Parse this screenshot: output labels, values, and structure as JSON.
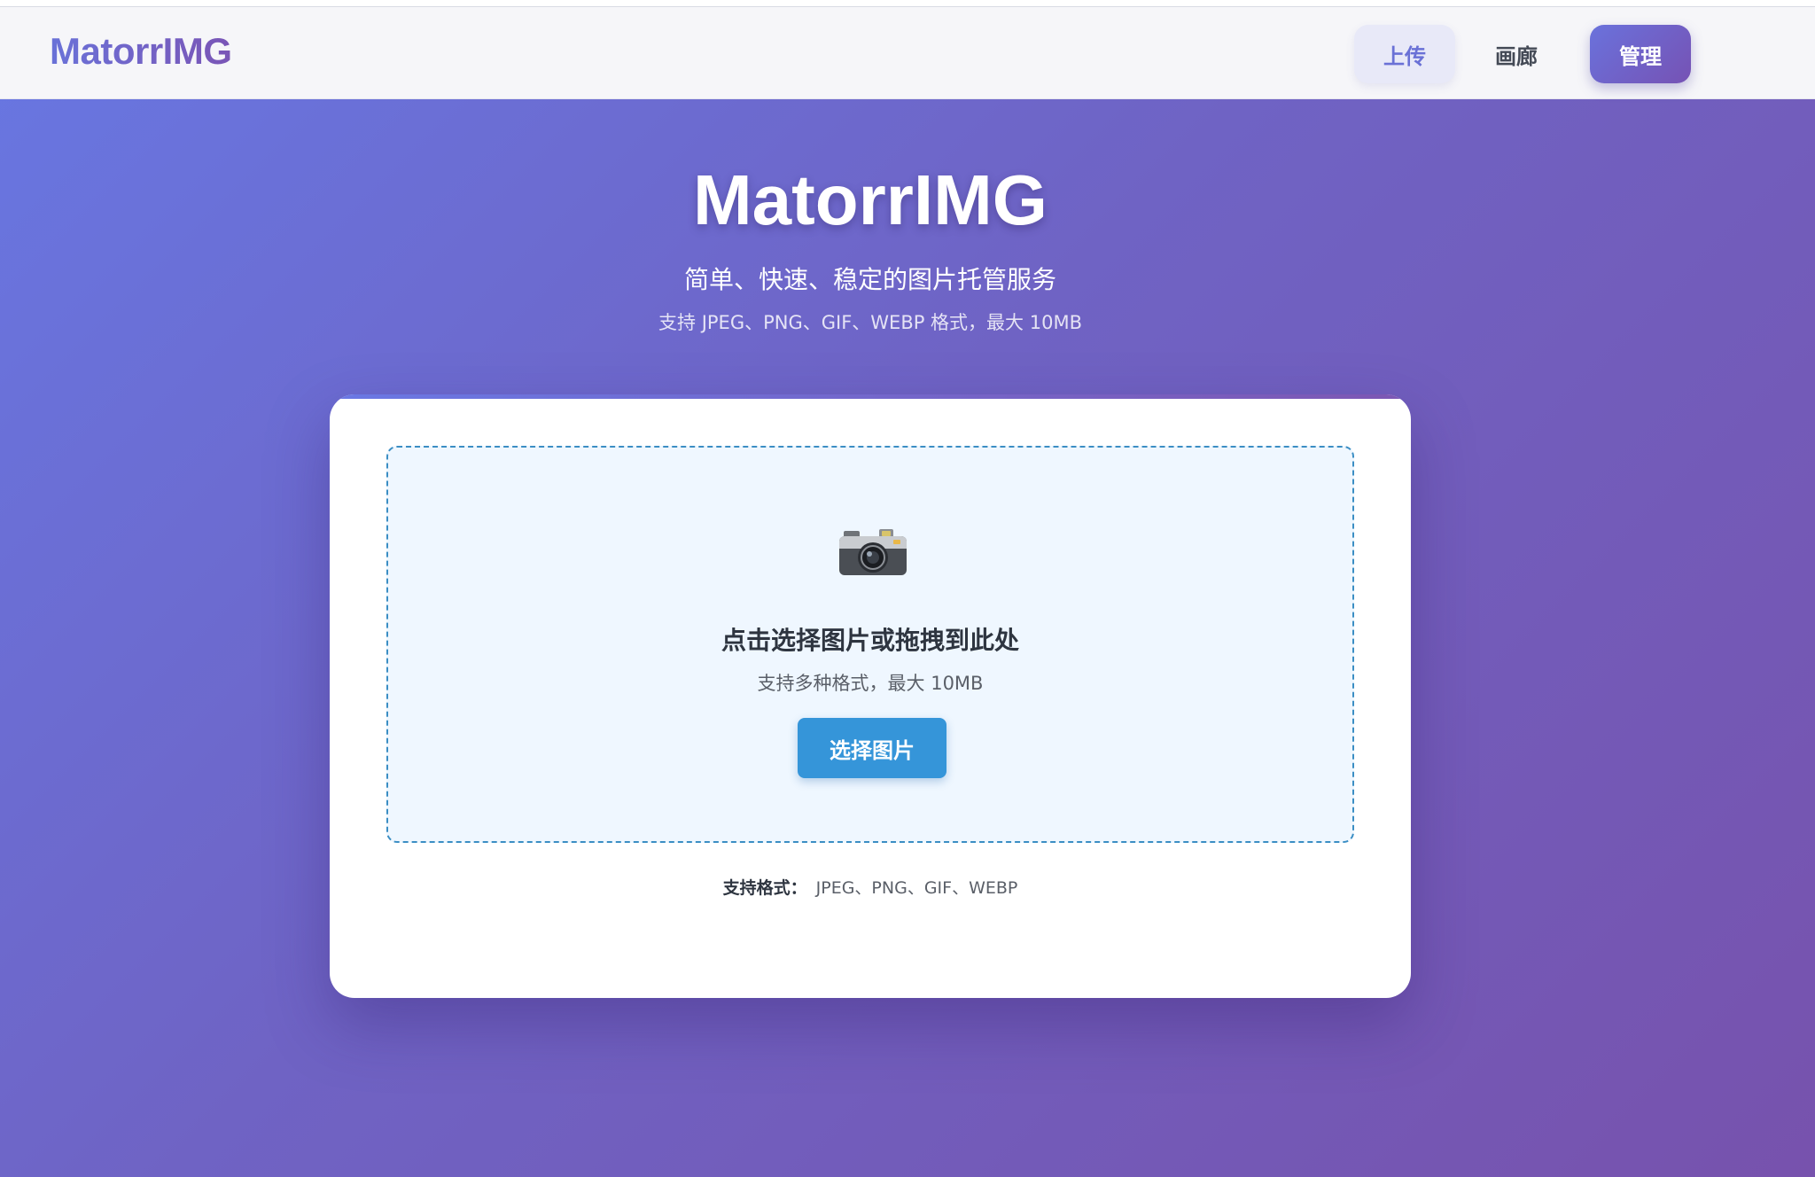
{
  "app": {
    "brand": "MatorrIMG"
  },
  "nav": {
    "upload_label": "上传",
    "gallery_label": "画廊",
    "admin_label": "管理"
  },
  "hero": {
    "title": "MatorrIMG",
    "subtitle": "简单、快速、稳定的图片托管服务",
    "note": "支持 JPEG、PNG、GIF、WEBP 格式，最大 10MB"
  },
  "upload": {
    "icon": "camera-icon",
    "drop_title": "点击选择图片或拖拽到此处",
    "drop_subtitle": "支持多种格式，最大 10MB",
    "choose_button": "选择图片",
    "formats_label": "支持格式：",
    "formats_value": "JPEG、PNG、GIF、WEBP"
  },
  "colors": {
    "accent": "#6a72d8",
    "button_blue": "#3595d9",
    "dropzone_border": "#3b8ec4",
    "dropzone_bg": "#eff7ff"
  }
}
